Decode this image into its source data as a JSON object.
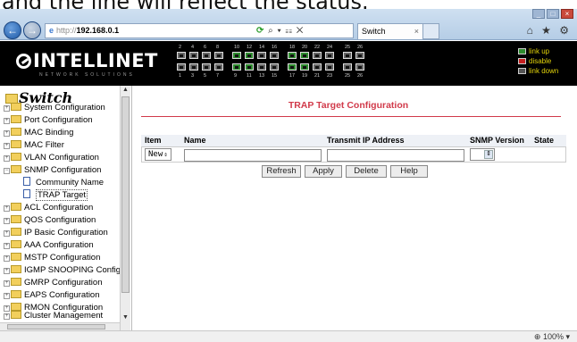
{
  "caption": "and the line will reflect the status.",
  "browser": {
    "address_proto": "http://",
    "address_host": "192.168.0.1",
    "address_tools": "⌕ ▾ ☷ ✕",
    "refresh_glyph": "⟳",
    "tab_title": "Switch",
    "tab_close": "×",
    "back_glyph": "←",
    "forward_glyph": "→",
    "icons": "⌂ ★ ⚙",
    "min": "_",
    "max": "□",
    "close": "×"
  },
  "header": {
    "logo": "INTELLINET",
    "logo_sub": "NETWORK SOLUTIONS",
    "ports_top": [
      "2",
      "4",
      "6",
      "8",
      "10",
      "12",
      "14",
      "16",
      "18",
      "20",
      "22",
      "24",
      "25",
      "26"
    ],
    "ports_bottom": [
      "1",
      "3",
      "5",
      "7",
      "9",
      "11",
      "13",
      "15",
      "17",
      "19",
      "21",
      "23",
      "25",
      "26"
    ],
    "legend": [
      "link up",
      "disable",
      "link down"
    ]
  },
  "tree": {
    "title": "Switch",
    "items": [
      {
        "label": "System Configuration"
      },
      {
        "label": "Port Configuration"
      },
      {
        "label": "MAC Binding"
      },
      {
        "label": "MAC Filter"
      },
      {
        "label": "VLAN Configuration"
      },
      {
        "label": "SNMP Configuration"
      },
      {
        "label": "Community Name"
      },
      {
        "label": "TRAP Target"
      },
      {
        "label": "ACL Configuration"
      },
      {
        "label": "QOS Configuration"
      },
      {
        "label": "IP Basic Configuration"
      },
      {
        "label": "AAA Configuration"
      },
      {
        "label": "MSTP Configuration"
      },
      {
        "label": "IGMP SNOOPING Config"
      },
      {
        "label": "GMRP Configuration"
      },
      {
        "label": "EAPS Configuration"
      },
      {
        "label": "RMON Configuration"
      },
      {
        "label": "Cluster Management"
      }
    ]
  },
  "main": {
    "title": "TRAP Target Configuration",
    "columns": [
      "Item",
      "Name",
      "Transmit IP Address",
      "SNMP Version",
      "State"
    ],
    "item_value": "New",
    "name_value": "",
    "ip_value": "",
    "snmp_value": "",
    "buttons": {
      "refresh": "Refresh",
      "apply": "Apply",
      "delete": "Delete",
      "help": "Help"
    }
  },
  "status": {
    "zoom": "100%"
  },
  "colors": {
    "accent": "#d13a4a",
    "header_bg": "#000000",
    "legend_text": "#e2d20a"
  }
}
